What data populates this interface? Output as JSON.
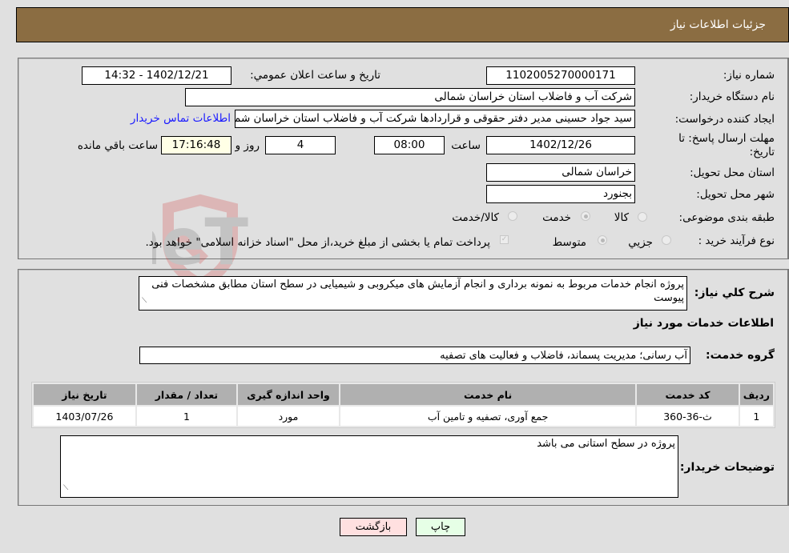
{
  "header": {
    "title": "جزئیات اطلاعات نیاز"
  },
  "form": {
    "need_number_label": "شماره نیاز:",
    "need_number": "1102005270000171",
    "announce_label": "تاریخ و ساعت اعلان عمومي:",
    "announce_value": "1402/12/21 - 14:32",
    "buyer_org_label": "نام دستگاه خریدار:",
    "buyer_org": "شرکت آب و فاضلاب استان خراسان شمالی",
    "creator_label": "ایجاد کننده درخواست:",
    "creator": "سید جواد حسینی مدیر دفتر حقوقی و قراردادها  شرکت آب و فاضلاب استان خراسان شمالی",
    "contact_link": "اطلاعات تماس خریدار",
    "deadline_label": "مهلت ارسال پاسخ: تا تاریخ:",
    "deadline_date": "1402/12/26",
    "time_label": "ساعت",
    "deadline_time": "08:00",
    "days_value": "4",
    "days_label": "روز و",
    "remaining_time": "17:16:48",
    "remaining_label": "ساعت باقي مانده",
    "province_label": "استان محل تحویل:",
    "province": "خراسان شمالی",
    "city_label": "شهر محل تحویل:",
    "city": "بجنورد",
    "category_label": "طبقه بندی موضوعی:",
    "category_options": [
      {
        "label": "کالا",
        "checked": false
      },
      {
        "label": "خدمت",
        "checked": true
      },
      {
        "label": "کالا/خدمت",
        "checked": false
      }
    ],
    "process_label": "نوع فرآیند خرید :",
    "process_options": [
      {
        "label": "جزيي",
        "checked": false
      },
      {
        "label": "متوسط",
        "checked": true
      }
    ],
    "payment_note": "پرداخت تمام یا بخشی از مبلغ خرید،از محل \"اسناد خزانه اسلامی\" خواهد بود.",
    "payment_checked": true
  },
  "details": {
    "summary_label": "شرح كلي نياز:",
    "summary": "پروژه انجام خدمات مربوط به نمونه برداری و انجام آزمایش های میکروبی و شیمیایی در سطح استان مطابق مشخصات فنی پیوست",
    "services_heading": "اطلاعات خدمات مورد نیاز",
    "service_group_label": "گروه خدمت:",
    "service_group": "آب رسانی؛ مدیریت پسماند، فاضلاب و فعالیت های تصفیه",
    "table": {
      "headers": [
        "ردیف",
        "کد خدمت",
        "نام خدمت",
        "واحد اندازه گیری",
        "تعداد / مقدار",
        "تاریخ نیاز"
      ],
      "rows": [
        [
          "1",
          "ث-36-360",
          "جمع آوری، تصفیه و تامین آب",
          "مورد",
          "1",
          "1403/07/26"
        ]
      ]
    },
    "buyer_notes_label": "توضیحات خریدار:",
    "buyer_notes": "پروژه در سطح استانی می باشد"
  },
  "buttons": {
    "print": "چاپ",
    "back": "بازگشت"
  },
  "watermark": {
    "text": "AriaTender.neT"
  }
}
